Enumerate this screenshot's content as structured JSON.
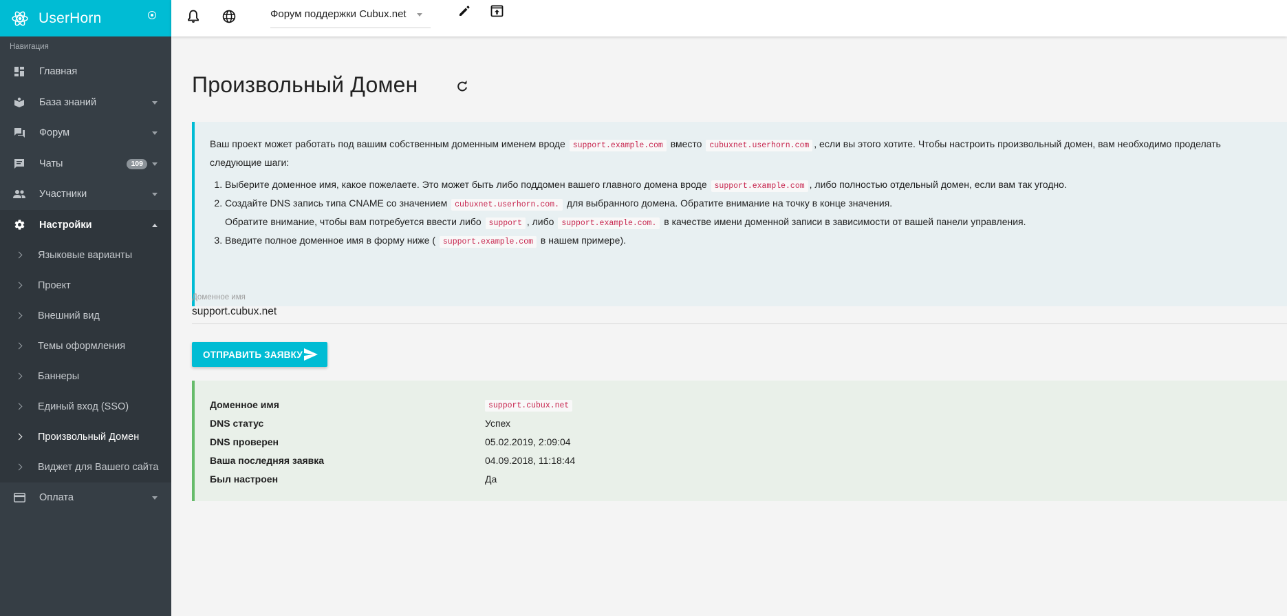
{
  "app": {
    "title": "UserHorn"
  },
  "sidebar": {
    "caption": "Навигация",
    "items": [
      {
        "label": "Главная",
        "icon": "dashboard-icon"
      },
      {
        "label": "База знаний",
        "icon": "book-icon"
      },
      {
        "label": "Форум",
        "icon": "forum-icon"
      },
      {
        "label": "Чаты",
        "icon": "chat-icon",
        "badge": "109"
      },
      {
        "label": "Участники",
        "icon": "people-icon"
      },
      {
        "label": "Настройки",
        "icon": "gear-icon"
      },
      {
        "label": "Оплата",
        "icon": "credit-card-icon"
      }
    ],
    "settings_sub": [
      "Языковые варианты",
      "Проект",
      "Внешний вид",
      "Темы оформления",
      "Баннеры",
      "Единый вход (SSO)",
      "Произвольный Домен",
      "Виджет для Вашего сайта"
    ]
  },
  "topbar": {
    "project": "Форум поддержки Cubux.net"
  },
  "page": {
    "title": "Произвольный Домен"
  },
  "info": {
    "intro_1": "Ваш проект может работать под вашим собственным доменным именем вроде",
    "code_example": "support.example.com",
    "intro_2": "вместо",
    "code_userhorn": "cubuxnet.userhorn.com",
    "intro_3": ", если вы этого хотите. Чтобы настроить произвольный домен, вам необходимо проделать следующие шаги:",
    "step1_a": "Выберите доменное имя, какое пожелаете. Это может быть либо поддомен вашего главного домена вроде",
    "step1_b": ", либо полностью отдельный домен, если вам так угодно.",
    "step2_a": "Создайте DNS запись типа CNAME со значением",
    "code_cname": "cubuxnet.userhorn.com.",
    "step2_b": "для выбранного домена. Обратите внимание на точку в конце значения.",
    "step2_note_a": "Обратите внимание, чтобы вам потребуется ввести либо",
    "code_support": "support",
    "step2_note_b": ", либо",
    "code_example_dot": "support.example.com.",
    "step2_note_c": "в качестве имени доменной записи в зависимости от вашей панели управления.",
    "step3_a": "Введите полное доменное имя в форму ниже (",
    "step3_b": "в нашем примере)."
  },
  "form": {
    "label": "Доменное имя",
    "value": "support.cubux.net",
    "submit": "ОТПРАВИТЬ ЗАЯВКУ"
  },
  "status": {
    "rows": [
      {
        "key": "Доменное имя",
        "value": "support.cubux.net"
      },
      {
        "key": "DNS статус",
        "value": "Успех"
      },
      {
        "key": "DNS проверен",
        "value": "05.02.2019, 2:09:04"
      },
      {
        "key": "Ваша последняя заявка",
        "value": "04.09.2018, 11:18:44"
      },
      {
        "key": "Был настроен",
        "value": "Да"
      }
    ]
  },
  "colors": {
    "accent": "#00bcd4",
    "sidebar": "#363e45",
    "success": "#66bb6a"
  }
}
